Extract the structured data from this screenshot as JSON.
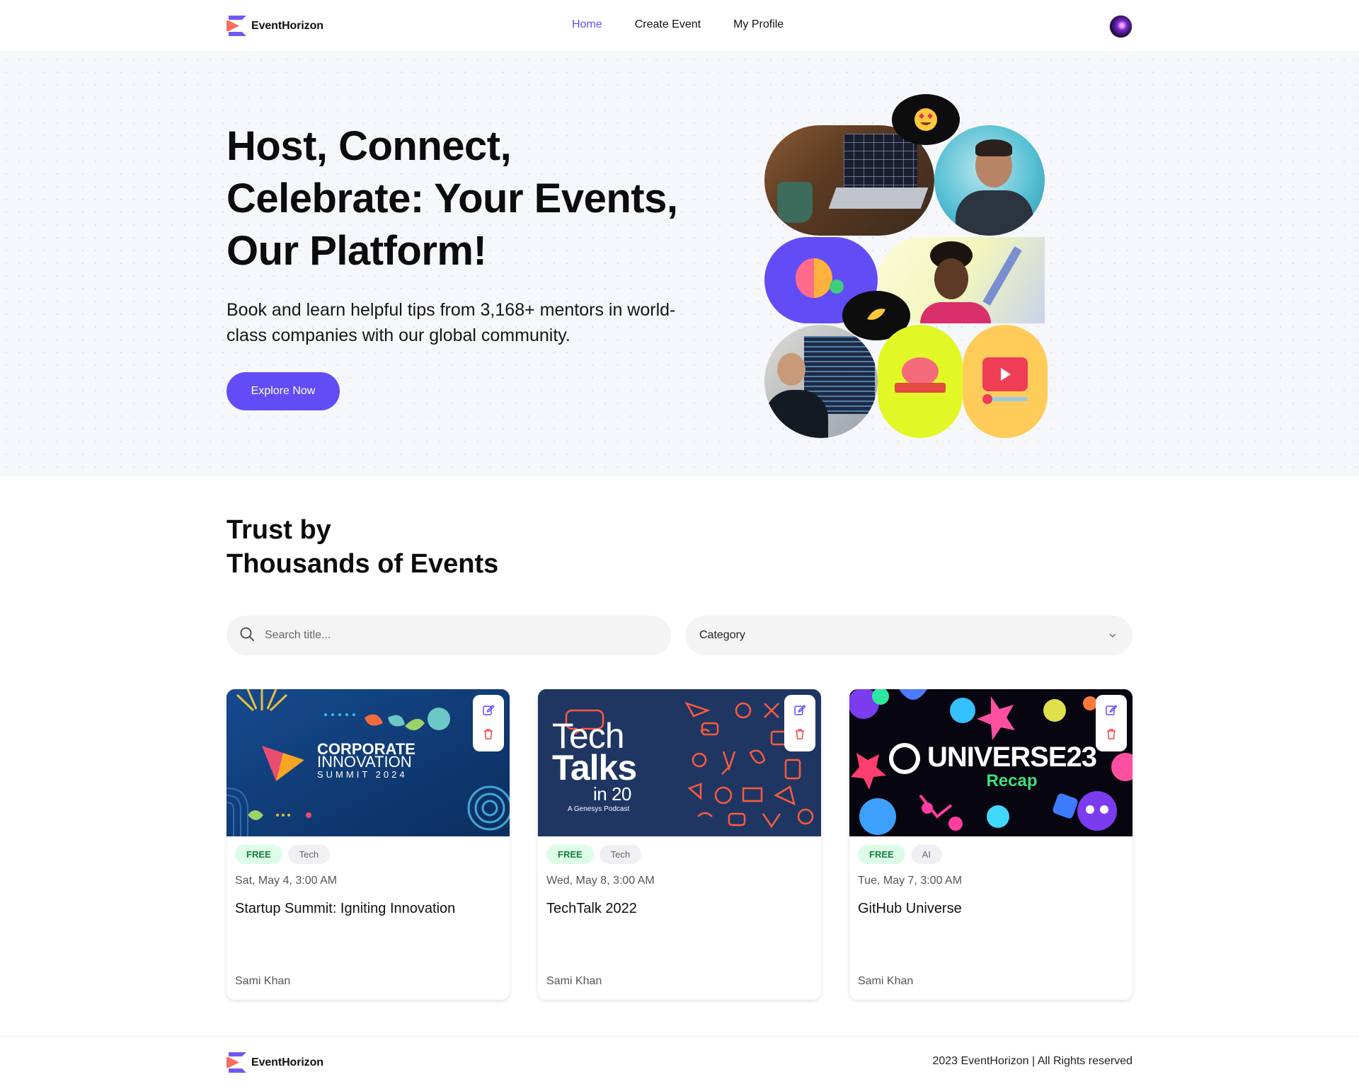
{
  "header": {
    "brand": "EventHorizon",
    "nav": [
      {
        "label": "Home",
        "active": true
      },
      {
        "label": "Create Event",
        "active": false
      },
      {
        "label": "My Profile",
        "active": false
      }
    ]
  },
  "hero": {
    "title": "Host, Connect, Celebrate: Your Events, Our Platform!",
    "subtitle": "Book and learn helpful tips from 3,168+ mentors in world-class companies with our global community.",
    "cta": "Explore Now"
  },
  "events_section": {
    "title_line1": "Trust by",
    "title_line2": "Thousands of Events",
    "search_placeholder": "Search title...",
    "category_label": "Category"
  },
  "events": [
    {
      "badge": "FREE",
      "category": "Tech",
      "date": "Sat, May 4, 3:00 AM",
      "title": "Startup Summit: Igniting Innovation",
      "author": "Sami Khan",
      "image": {
        "line1": "CORPORATE",
        "line2": "INNOVATION",
        "line3": "SUMMIT 2024"
      }
    },
    {
      "badge": "FREE",
      "category": "Tech",
      "date": "Wed, May 8, 3:00 AM",
      "title": "TechTalk 2022",
      "author": "Sami Khan",
      "image": {
        "line1": "Tech",
        "line2": "Talks",
        "line3": "in 20",
        "line4": "A Genesys Podcast"
      }
    },
    {
      "badge": "FREE",
      "category": "AI",
      "date": "Tue, May 7, 3:00 AM",
      "title": "GitHub Universe",
      "author": "Sami Khan",
      "image": {
        "line1": "UNIVERSE23",
        "line2": "Recap"
      }
    }
  ],
  "footer": {
    "brand": "EventHorizon",
    "copyright": "2023 EventHorizon | All Rights reserved"
  },
  "colors": {
    "primary": "#624CF5",
    "free_badge_bg": "#dcfce7",
    "free_badge_text": "#15803d",
    "delete_red": "#ef4444",
    "hero_bg": "#f6f7fb"
  },
  "icons": [
    "logo-icon",
    "search-icon",
    "chevron-down-icon",
    "edit-icon",
    "trash-icon"
  ]
}
